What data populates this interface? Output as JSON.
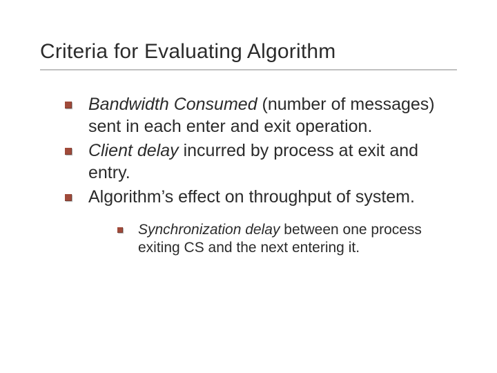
{
  "title": "Criteria for Evaluating Algorithm",
  "bullets": [
    {
      "em": "Bandwidth Consumed",
      "rest": " (number of messages) sent in each enter and exit operation."
    },
    {
      "em": "Client delay",
      "rest": " incurred by process at exit and entry."
    },
    {
      "em": "",
      "rest": "Algorithm’s effect on throughput of system."
    }
  ],
  "sub": {
    "em": "Synchronization delay",
    "rest": " between one process exiting CS and the next entering it."
  }
}
